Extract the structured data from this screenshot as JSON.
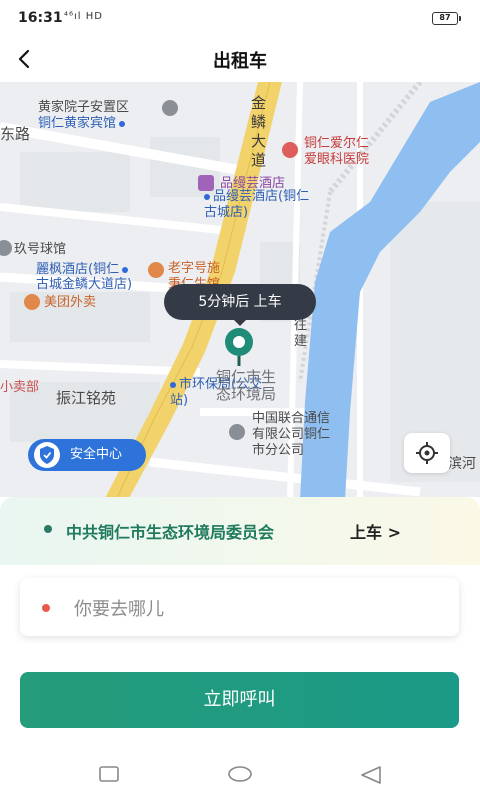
{
  "status_bar": {
    "time": "16:31",
    "network": "⁴⁶ıl HD",
    "battery": "87"
  },
  "header": {
    "title": "出租车"
  },
  "map": {
    "roads": {
      "jinlin_avenue": "金鳞大道",
      "east_road_fragment": "东路",
      "right_fragment": "滨河"
    },
    "labels": {
      "huangjia_anzhi": "黄家院子安置区",
      "tongren_huangjia_hotel": "铜仁黄家宾馆",
      "tongren_aier_line1": "铜仁爱尔仁",
      "tongren_aier_line2": "爱眼科医院",
      "pinyuyun_hotel": "品缦芸酒店",
      "pinyuyun_branch_line1": "品缦芸酒店(铜仁",
      "pinyuyun_branch_line2": "古城店)",
      "jiuhao_billiards": "玖号球馆",
      "lifeng_line1": "麗枫酒店(铜仁",
      "lifeng_line2": "古城金鳞大道店)",
      "laozihao_line1": "老字号施",
      "laozihao_line2": "秉仁生馆",
      "meituan": "美团外卖",
      "env_bureau_blue_line1": "市环保局(公交",
      "env_bureau_blue_line2": "站)",
      "env_bureau_grey_line1": "铜仁市生",
      "env_bureau_grey_line2": "态环境局",
      "zhenjiang": "振江铭苑",
      "xiaomaibu": "小卖部",
      "unicom_line1": "中国联合通信",
      "unicom_line2": "有限公司铜仁",
      "unicom_line3": "市分公司",
      "jian_fragment1": "往",
      "jian_fragment2": "建"
    },
    "eta_text": "5分钟后 上车",
    "safety_center": "安全中心"
  },
  "pickup": {
    "location": "中共铜仁市生态环境局委员会",
    "action": "上车 >"
  },
  "destination": {
    "placeholder": "你要去哪儿"
  },
  "call_button": "立即呼叫",
  "colors": {
    "primary": "#1f9a80",
    "safety_blue": "#2e73d9",
    "river": "#8fbff0",
    "road": "#f2d36b"
  },
  "icons": [
    "back-arrow-icon",
    "battery-icon",
    "location-pin-icon",
    "shield-icon",
    "locate-icon",
    "hospital-icon",
    "hotel-icon",
    "food-icon"
  ]
}
